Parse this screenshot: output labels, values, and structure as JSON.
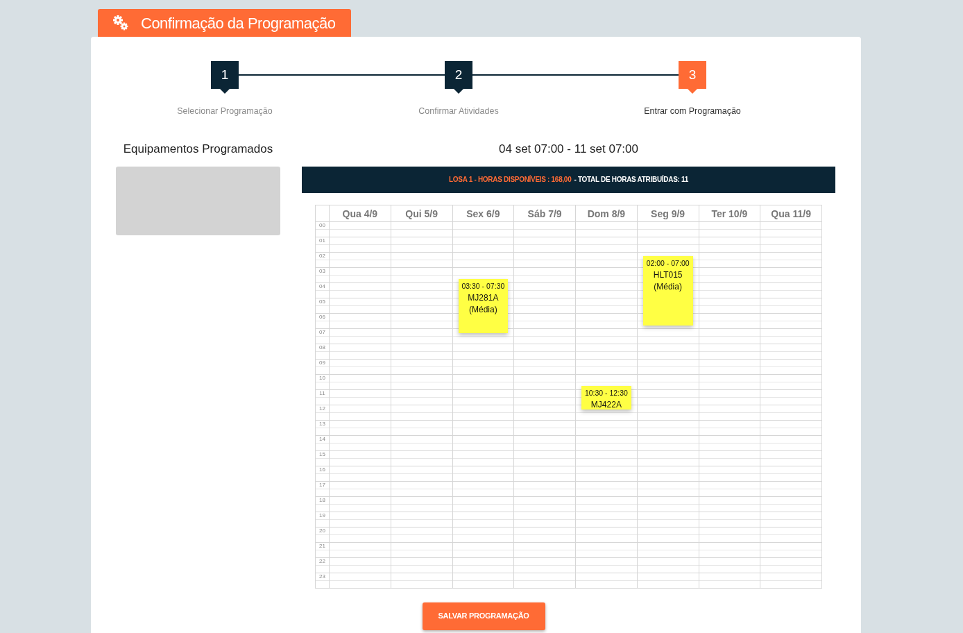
{
  "header": {
    "title": "Confirmação da Programação"
  },
  "steps": [
    {
      "number": "1",
      "label": "Selecionar Programação",
      "selected": false
    },
    {
      "number": "2",
      "label": "Confirmar Atividades",
      "selected": false
    },
    {
      "number": "3",
      "label": "Entrar com Programação",
      "selected": true
    }
  ],
  "equipment": {
    "title": "Equipamentos Programados"
  },
  "schedule": {
    "range": "04 set 07:00 - 11 set 07:00",
    "summary": {
      "available": "LOSA 1 - HORAS DISPONÍVEIS : 168,00",
      "assigned": "- TOTAL DE HORAS ATRIBUÍDAS: 11"
    },
    "hours": [
      "00",
      "01",
      "02",
      "03",
      "04",
      "05",
      "06",
      "07",
      "08",
      "09",
      "10",
      "11",
      "12",
      "13",
      "14",
      "15",
      "16",
      "17",
      "18",
      "19",
      "20",
      "21",
      "22",
      "23"
    ],
    "days": [
      {
        "label": "Qua 4/9"
      },
      {
        "label": "Qui 5/9"
      },
      {
        "label": "Sex 6/9",
        "events": [
          {
            "time": "03:30 - 07:30",
            "code": "MJ281A",
            "note": "(Média)"
          }
        ]
      },
      {
        "label": "Sáb 7/9"
      },
      {
        "label": "Dom 8/9",
        "events": [
          {
            "time": "10:30 - 12:30",
            "code": "MJ422A"
          }
        ]
      },
      {
        "label": "Seg 9/9",
        "events": [
          {
            "time": "02:00 - 07:00",
            "code": "HLT015",
            "note": "(Média)"
          }
        ]
      },
      {
        "label": "Ter 10/9"
      },
      {
        "label": "Qua 11/9"
      }
    ]
  },
  "save_button": "SALVAR PROGRAMAÇÃO"
}
